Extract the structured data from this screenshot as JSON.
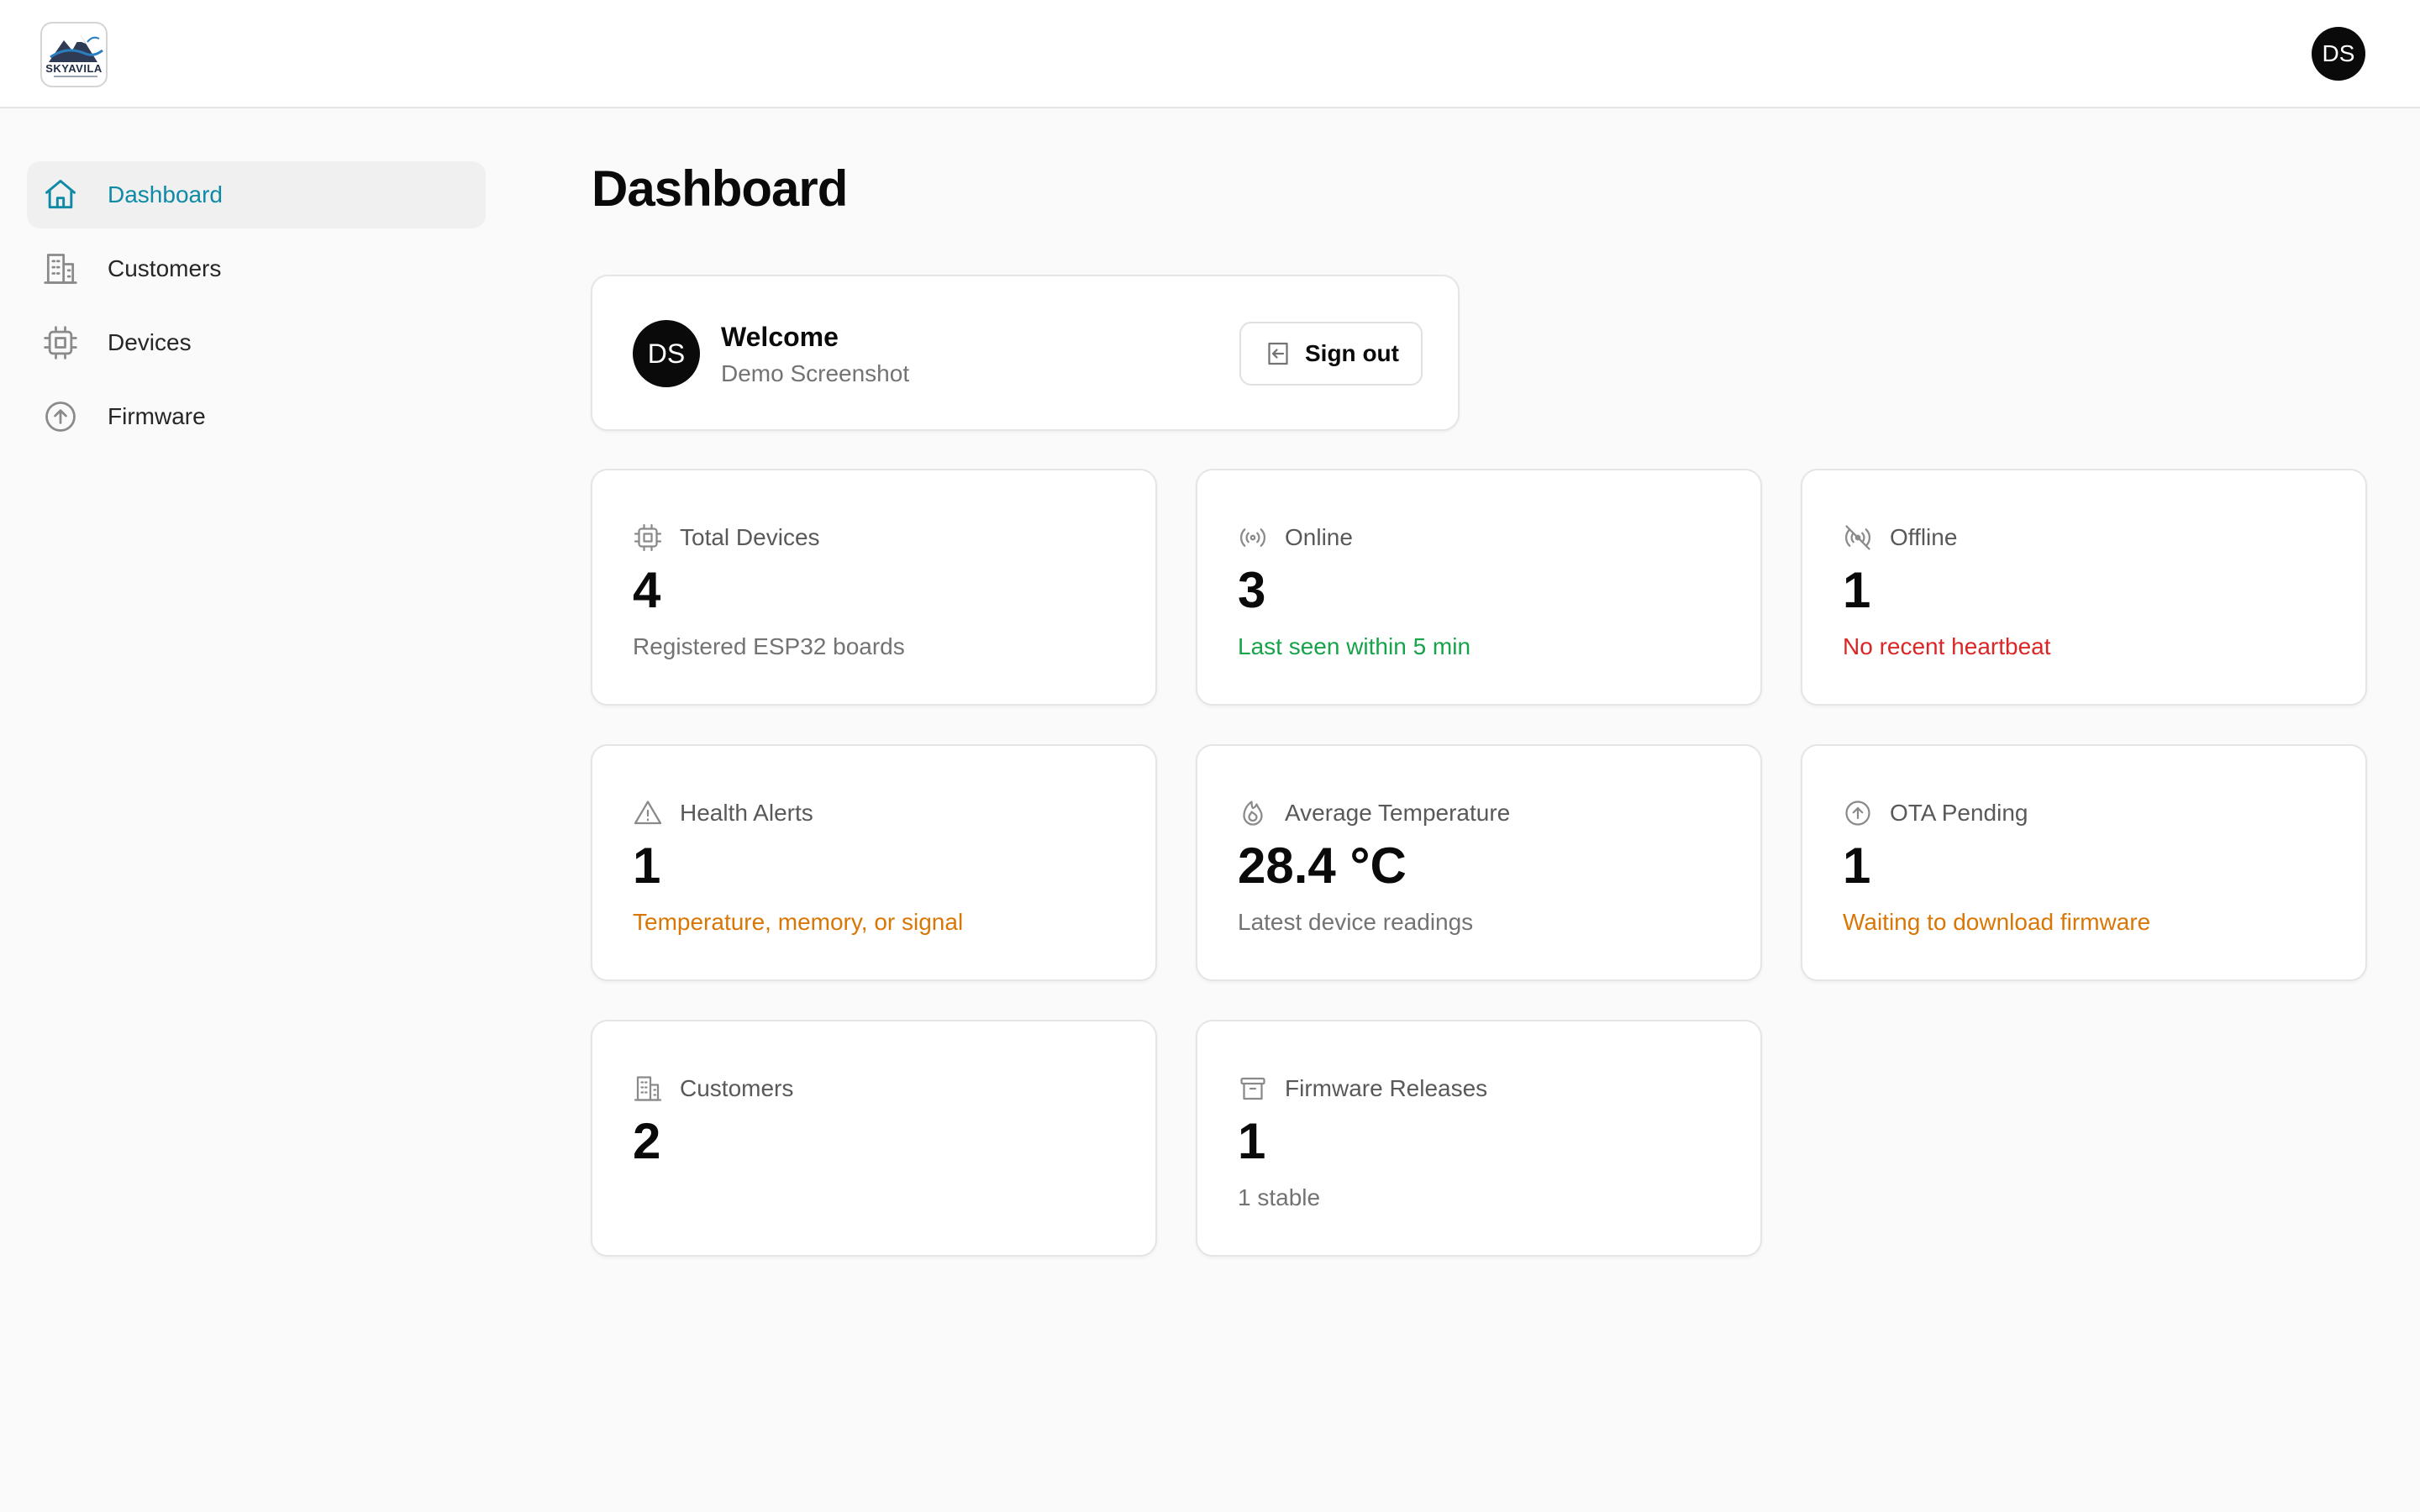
{
  "header": {
    "logo_text": "SKYAVILA",
    "user_initials": "DS"
  },
  "sidebar": {
    "items": [
      {
        "label": "Dashboard",
        "icon": "home-icon",
        "active": true
      },
      {
        "label": "Customers",
        "icon": "building-icon",
        "active": false
      },
      {
        "label": "Devices",
        "icon": "chip-icon",
        "active": false
      },
      {
        "label": "Firmware",
        "icon": "upload-circle-icon",
        "active": false
      }
    ]
  },
  "page": {
    "title": "Dashboard"
  },
  "welcome": {
    "initials": "DS",
    "title": "Welcome",
    "subtitle": "Demo Screenshot",
    "signout_label": "Sign out"
  },
  "stats": [
    {
      "label": "Total Devices",
      "icon": "chip-icon",
      "value": "4",
      "desc": "Registered ESP32 boards",
      "desc_color": "#737373"
    },
    {
      "label": "Online",
      "icon": "broadcast-icon",
      "value": "3",
      "desc": "Last seen within 5 min",
      "desc_color": "#16a34a"
    },
    {
      "label": "Offline",
      "icon": "broadcast-off-icon",
      "value": "1",
      "desc": "No recent heartbeat",
      "desc_color": "#dc2626"
    },
    {
      "label": "Health Alerts",
      "icon": "warning-icon",
      "value": "1",
      "desc": "Temperature, memory, or signal",
      "desc_color": "#d97706"
    },
    {
      "label": "Average Temperature",
      "icon": "flame-icon",
      "value": "28.4 °C",
      "desc": "Latest device readings",
      "desc_color": "#737373"
    },
    {
      "label": "OTA Pending",
      "icon": "upload-circle-icon",
      "value": "1",
      "desc": "Waiting to download firmware",
      "desc_color": "#d97706"
    },
    {
      "label": "Customers",
      "icon": "building-icon",
      "value": "2",
      "desc": "",
      "desc_color": "#737373"
    },
    {
      "label": "Firmware Releases",
      "icon": "archive-icon",
      "value": "1",
      "desc": "1 stable",
      "desc_color": "#737373"
    }
  ],
  "colors": {
    "accent": "#0e8aa6",
    "success": "#16a34a",
    "danger": "#dc2626",
    "warning": "#d97706"
  }
}
